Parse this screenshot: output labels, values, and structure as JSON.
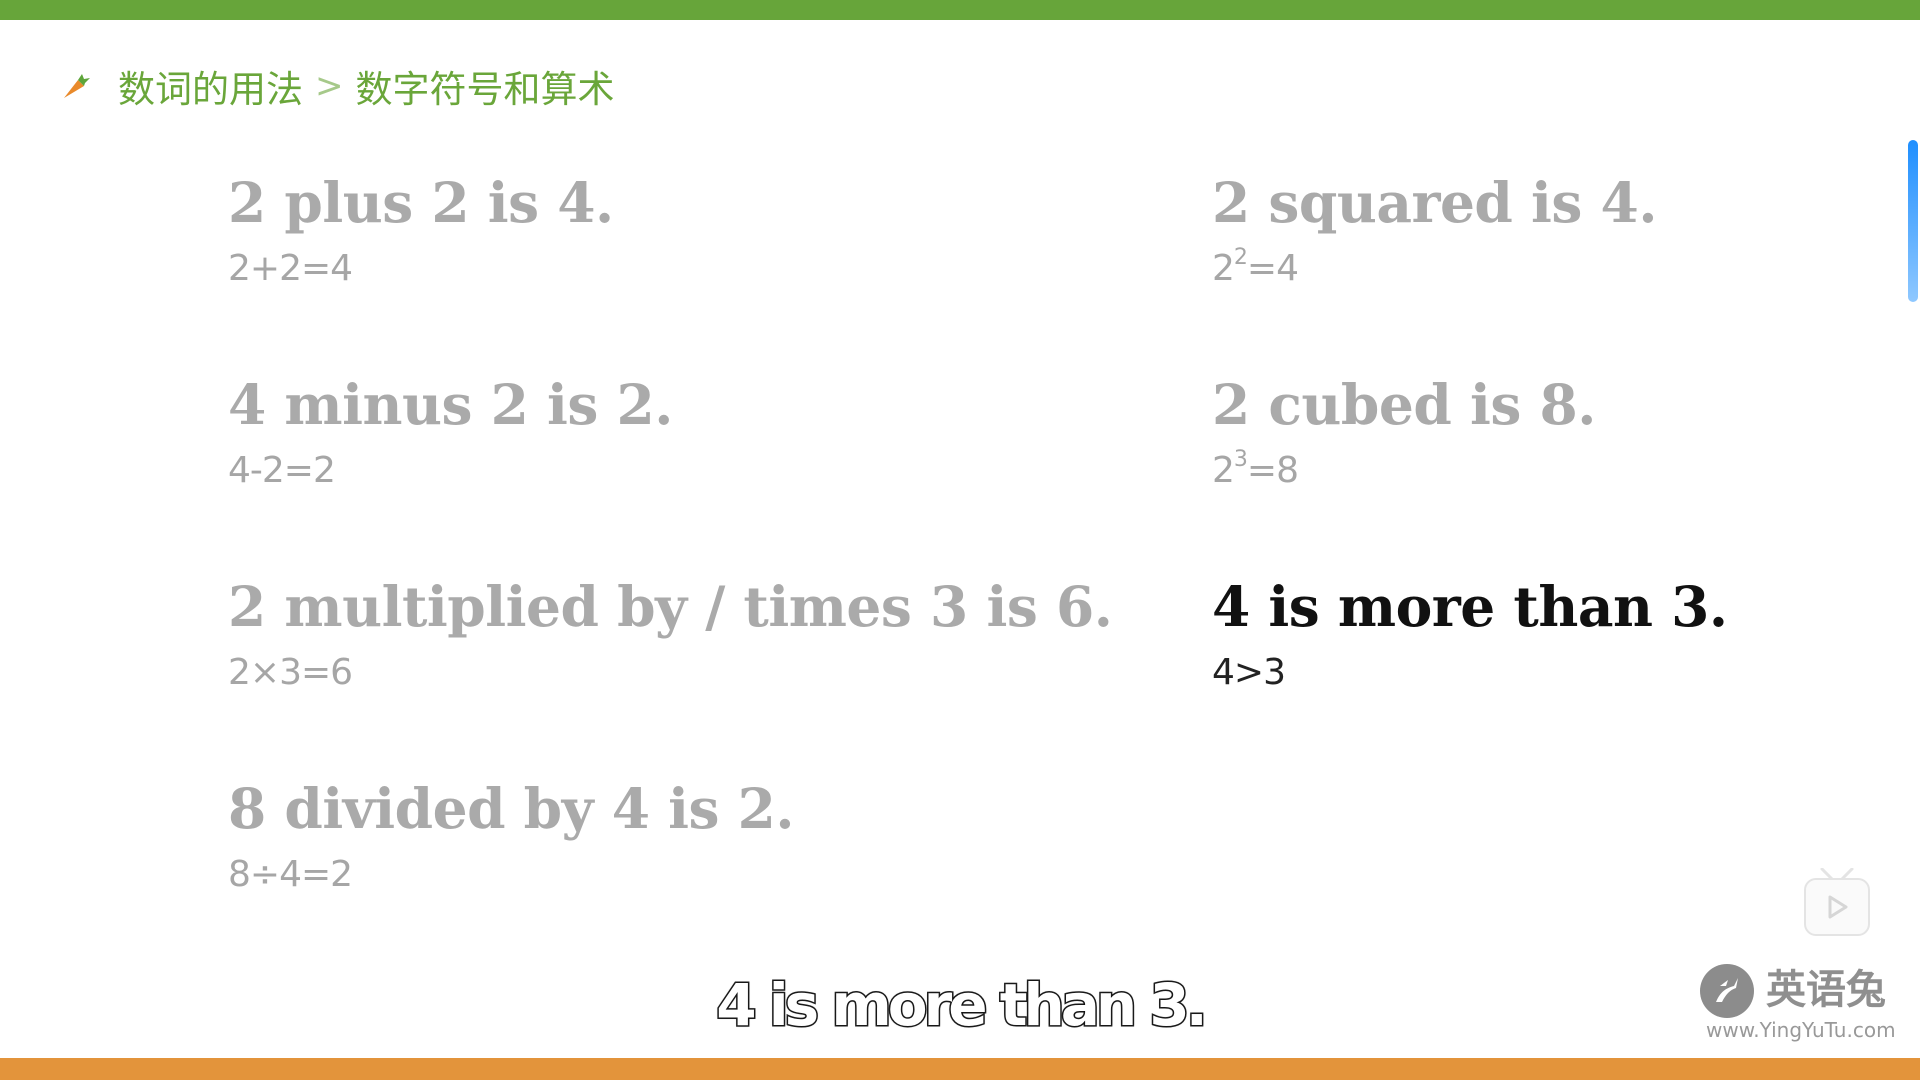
{
  "breadcrumb": {
    "parent": "数词的用法",
    "separator": ">",
    "current": "数字符号和算术"
  },
  "items": [
    {
      "en": "2 plus 2 is 4.",
      "math": "2+2=4",
      "active": false
    },
    {
      "en": "4 minus 2 is 2.",
      "math": "4-2=2",
      "active": false
    },
    {
      "en": "2 multiplied by / times 3 is 6.",
      "math": "2×3=6",
      "active": false
    },
    {
      "en": "8 divided by 4 is 2.",
      "math": "8÷4=2",
      "active": false
    },
    {
      "en": "2 squared is 4.",
      "math_base": "2",
      "math_exp": "2",
      "math_rest": "=4",
      "active": false
    },
    {
      "en": "2 cubed is 8.",
      "math_base": "2",
      "math_exp": "3",
      "math_rest": "=8",
      "active": false
    },
    {
      "en": "4 is more than 3.",
      "math": "4>3",
      "active": true
    }
  ],
  "subtitle": "4 is more than 3.",
  "logo": {
    "name": "英语兔",
    "url": "www.YingYuTu.com"
  },
  "colors": {
    "top_bar": "#67a53a",
    "bottom_bar": "#e3943b",
    "breadcrumb": "#6aa63a",
    "inactive_text": "#aaaaaa",
    "active_text": "#111111",
    "scroll_indicator": "#1f8fff"
  },
  "icons": {
    "breadcrumb": "carrot-icon",
    "player": "play-icon",
    "logo": "rabbit-icon"
  }
}
